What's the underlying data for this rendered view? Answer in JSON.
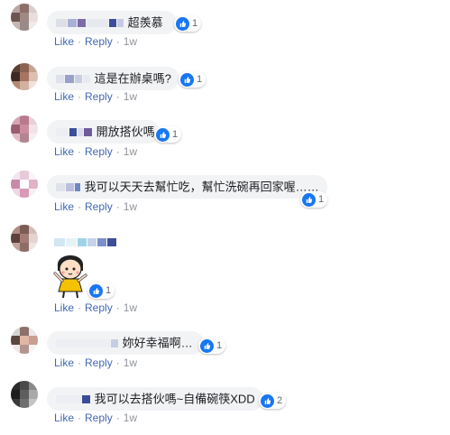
{
  "actions": {
    "like": "Like",
    "reply": "Reply",
    "time": "1w",
    "separator": "·"
  },
  "comments": [
    {
      "text": "超羨慕",
      "reactions": "1"
    },
    {
      "text": "這是在辦桌嗎?",
      "reactions": "1"
    },
    {
      "text": "開放搭伙嗎",
      "reactions": "1"
    },
    {
      "text": "我可以天天去幫忙吃，幫忙洗碗再回家喔……",
      "reactions": "1"
    },
    {
      "text": "",
      "reactions": "1",
      "sticker": "cartoon-girl-sticker"
    },
    {
      "text": "妳好幸福啊…",
      "reactions": "1"
    },
    {
      "text": "我可以去搭伙嗎~自備碗筷XDD",
      "reactions": "2"
    }
  ],
  "colors": {
    "bubble": "#f2f3f5",
    "link": "#4267b2",
    "meta": "#90949c",
    "like_blue": "#1877f2"
  }
}
